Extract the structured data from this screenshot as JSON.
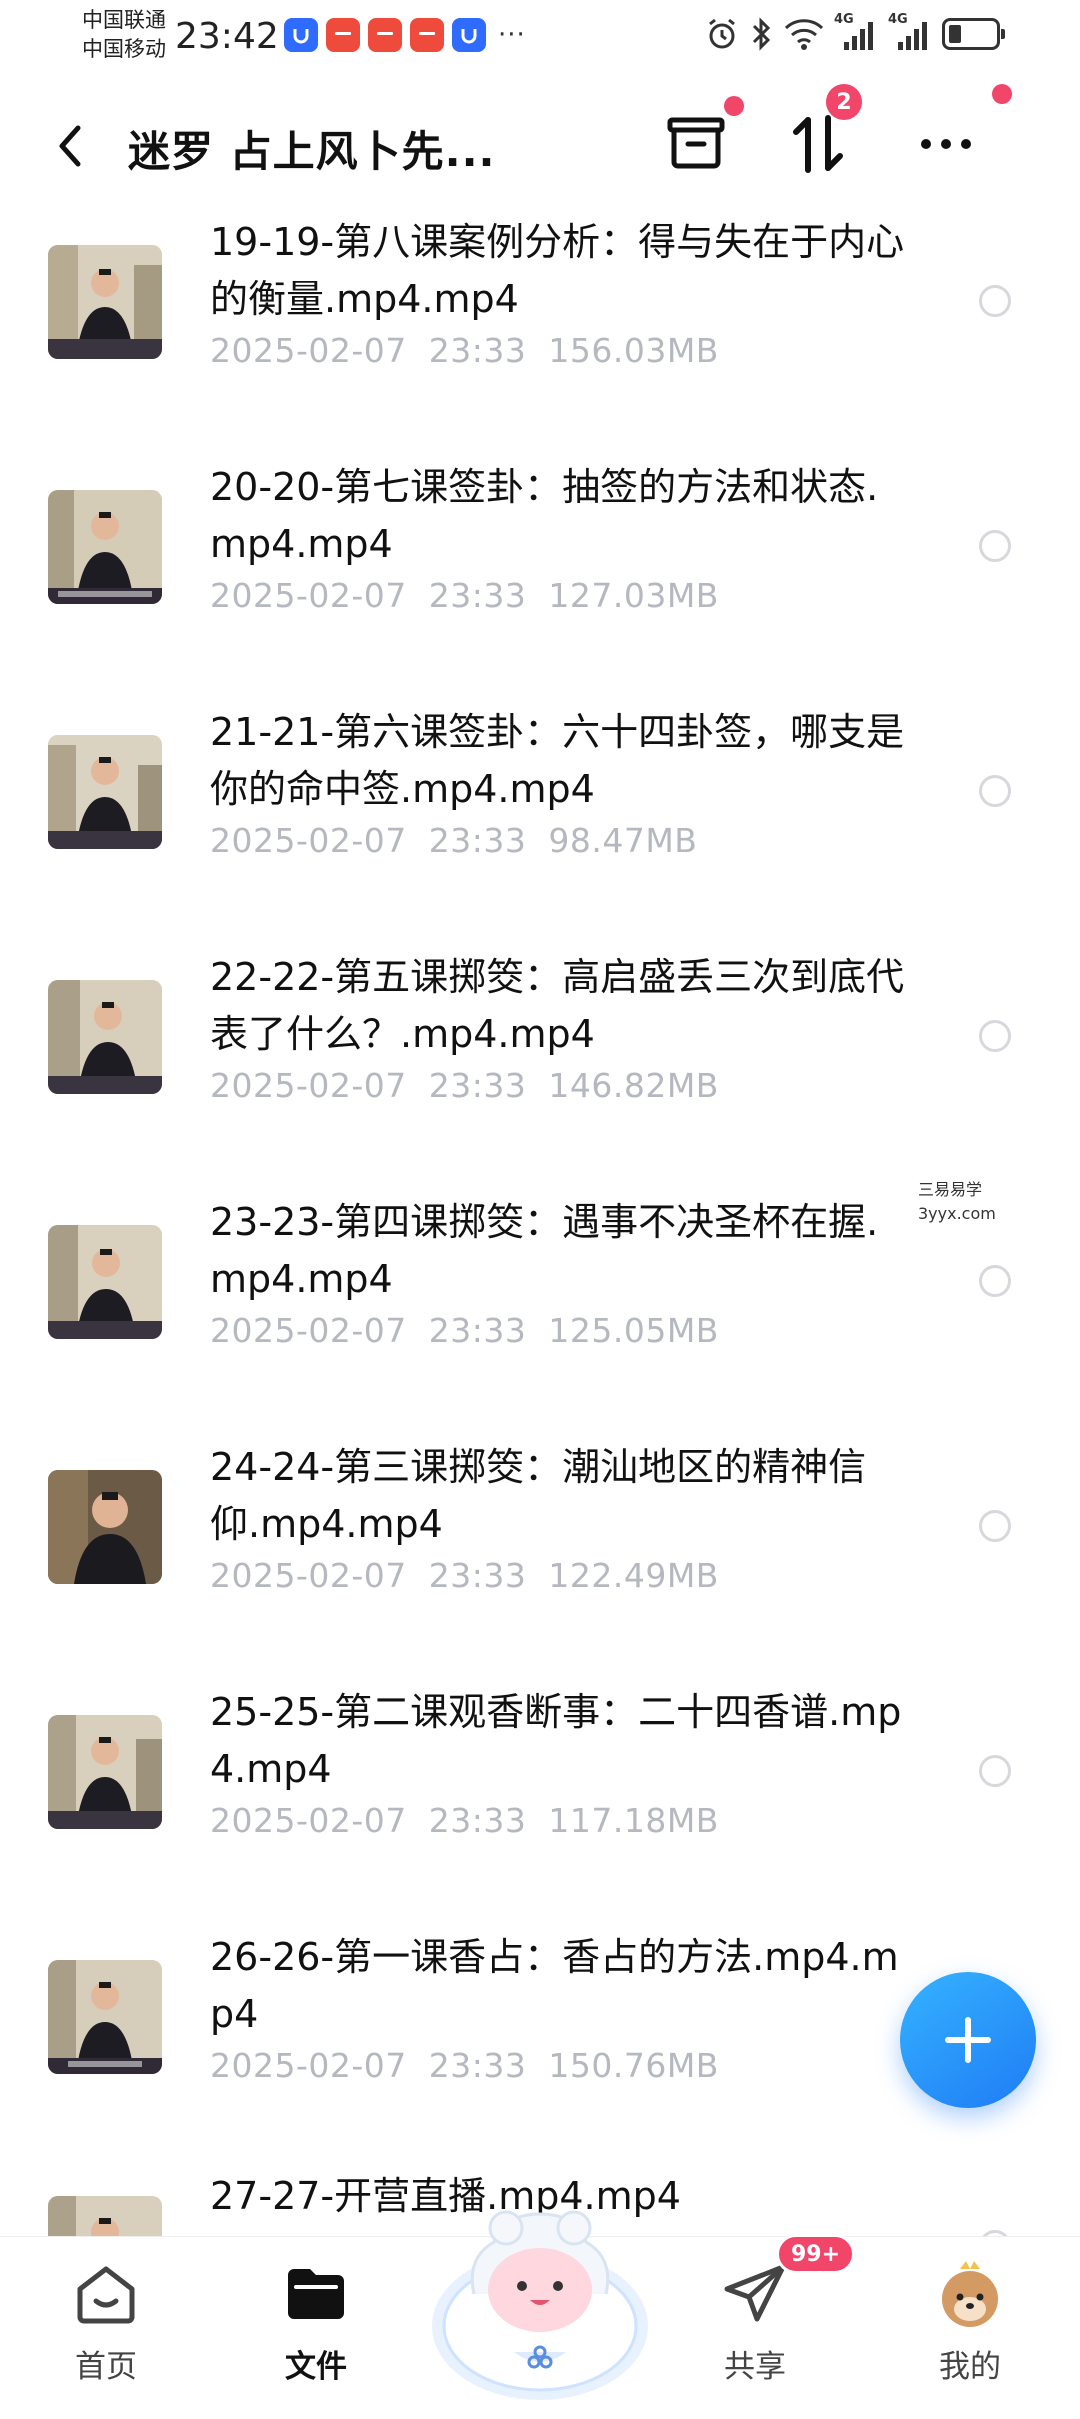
{
  "status_bar": {
    "carrier1": "中国联通",
    "carrier2": "中国移动",
    "time": "23:42",
    "more": "···",
    "network1": "4G",
    "network2": "4G"
  },
  "header": {
    "title": "迷罗 占上风卜先...",
    "transfer_count": "2"
  },
  "files": [
    {
      "name": "19-19-第八课案例分析：得与失在于内心的衡量.mp4.mp4",
      "date": "2025-02-07",
      "time": "23:33",
      "size": "156.03MB"
    },
    {
      "name": "20-20-第七课签卦：抽签的方法和状态.mp4.mp4",
      "date": "2025-02-07",
      "time": "23:33",
      "size": "127.03MB"
    },
    {
      "name": "21-21-第六课签卦：六十四卦签，哪支是你的命中签.mp4.mp4",
      "date": "2025-02-07",
      "time": "23:33",
      "size": "98.47MB"
    },
    {
      "name": "22-22-第五课掷筊：高启盛丢三次到底代表了什么？.mp4.mp4",
      "date": "2025-02-07",
      "time": "23:33",
      "size": "146.82MB"
    },
    {
      "name": "23-23-第四课掷筊：遇事不决圣杯在握.mp4.mp4",
      "date": "2025-02-07",
      "time": "23:33",
      "size": "125.05MB"
    },
    {
      "name": "24-24-第三课掷筊：潮汕地区的精神信仰.mp4.mp4",
      "date": "2025-02-07",
      "time": "23:33",
      "size": "122.49MB"
    },
    {
      "name": "25-25-第二课观香断事：二十四香谱.mp4.mp4",
      "date": "2025-02-07",
      "time": "23:33",
      "size": "117.18MB"
    },
    {
      "name": "26-26-第一课香占：香占的方法.mp4.mp4",
      "date": "2025-02-07",
      "time": "23:33",
      "size": "150.76MB"
    },
    {
      "name": "27-27-开营直播.mp4.mp4",
      "date": "",
      "time": "",
      "size": ""
    }
  ],
  "watermark": {
    "line1": "三易易学",
    "line2": "3yyx.com"
  },
  "bottom_nav": {
    "home": "首页",
    "files": "文件",
    "share": "共享",
    "mine": "我的",
    "share_badge": "99+"
  }
}
